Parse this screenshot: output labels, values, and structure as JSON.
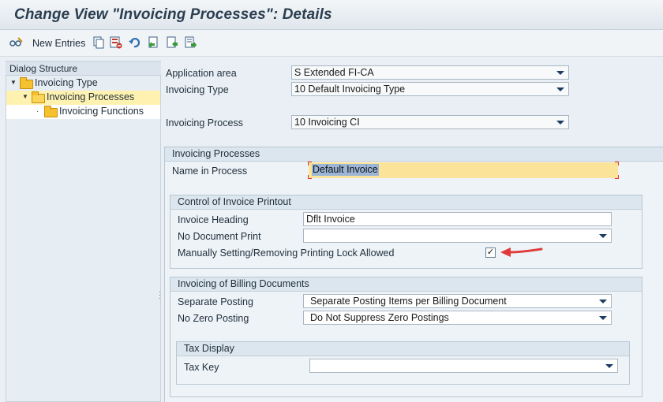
{
  "title": "Change View \"Invoicing Processes\": Details",
  "toolbar": {
    "new_entries_label": "New Entries",
    "icons": [
      "glasses-pencil-icon",
      "copy-icon",
      "delete-icon",
      "undo-icon",
      "select-all-icon",
      "previous-entry-icon",
      "next-entry-icon"
    ]
  },
  "dialog_structure": {
    "header": "Dialog Structure",
    "items": [
      {
        "label": "Invoicing Type",
        "level": 0,
        "expanded": true
      },
      {
        "label": "Invoicing Processes",
        "level": 1,
        "expanded": true,
        "selected": true
      },
      {
        "label": "Invoicing Functions",
        "level": 2
      }
    ]
  },
  "header_fields": {
    "application_area_label": "Application area",
    "application_area_value": "S Extended FI-CA",
    "invoicing_type_label": "Invoicing Type",
    "invoicing_type_value": "10 Default Invoicing Type",
    "invoicing_process_label": "Invoicing Process",
    "invoicing_process_value": "10 Invoicing CI"
  },
  "invoicing_processes": {
    "header": "Invoicing Processes",
    "name_label": "Name in Process",
    "name_value": "Default Invoice"
  },
  "printout": {
    "header": "Control of Invoice Printout",
    "heading_label": "Invoice Heading",
    "heading_value": "Dflt Invoice",
    "no_doc_print_label": "No Document Print",
    "no_doc_print_value": "",
    "lock_label": "Manually Setting/Removing Printing Lock Allowed",
    "lock_checked": "✓"
  },
  "billing": {
    "header": "Invoicing of Billing Documents",
    "separate_posting_label": "Separate Posting",
    "separate_posting_value": "Separate Posting Items per Billing Document",
    "zero_posting_label": "No Zero Posting",
    "zero_posting_value": "Do Not Suppress Zero Postings"
  },
  "tax": {
    "header": "Tax Display",
    "tax_key_label": "Tax Key",
    "tax_key_value": ""
  },
  "colors": {
    "title": "#2b3e50",
    "highlight_field": "#fbe39a",
    "annotation_arrow": "#e03a3a",
    "dropdown_arrow": "#1d3b63"
  }
}
